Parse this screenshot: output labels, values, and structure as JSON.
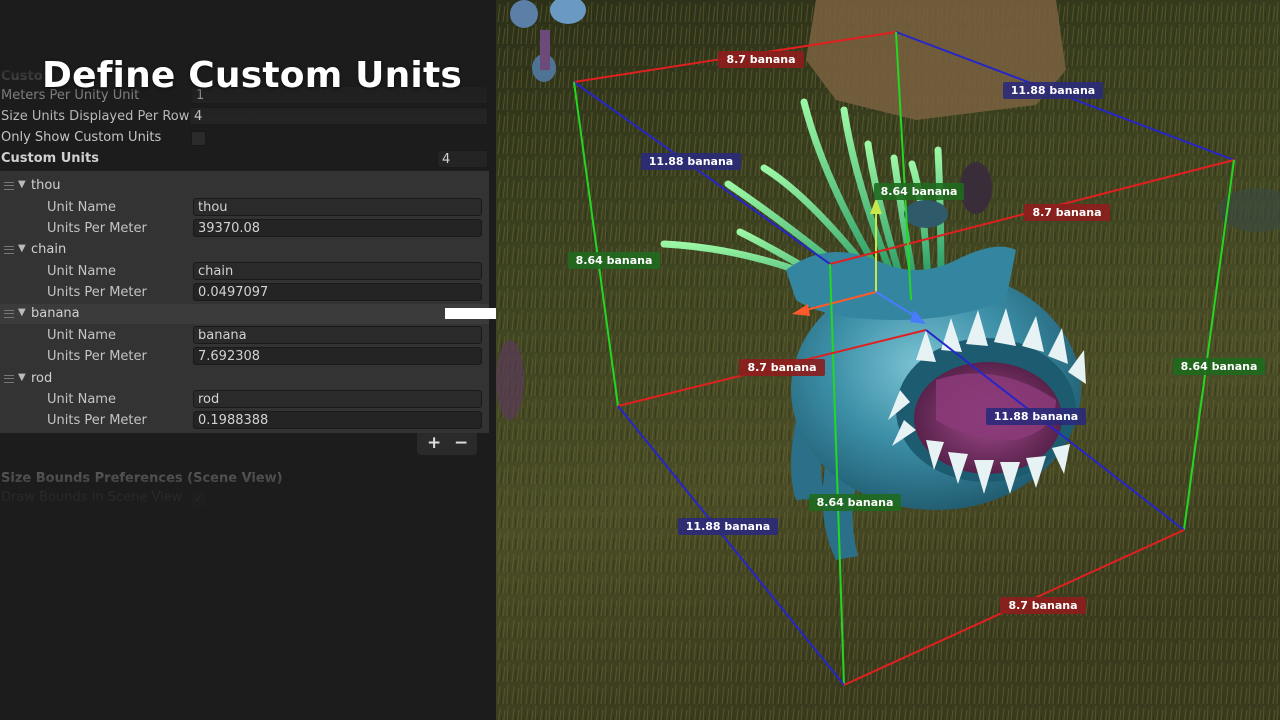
{
  "headline": "Define Custom Units",
  "inspector": {
    "section_title_partial": "Custo",
    "meters_per_unity_unit": {
      "label": "Meters Per Unity Unit",
      "value": "1"
    },
    "size_units_per_row": {
      "label": "Size Units Displayed Per Row",
      "value": "4"
    },
    "only_show_custom": {
      "label": "Only Show Custom Units",
      "checked": false
    },
    "custom_units": {
      "label": "Custom Units",
      "count": "4",
      "unit_name_label": "Unit Name",
      "units_per_meter_label": "Units Per Meter",
      "items": [
        {
          "header": "thou",
          "unit_name": "thou",
          "units_per_meter": "39370.08"
        },
        {
          "header": "chain",
          "unit_name": "chain",
          "units_per_meter": "0.0497097"
        },
        {
          "header": "banana",
          "unit_name": "banana",
          "units_per_meter": "7.692308"
        },
        {
          "header": "rod",
          "unit_name": "rod",
          "units_per_meter": "0.1988388"
        }
      ],
      "add_symbol": "+",
      "remove_symbol": "−"
    },
    "bounds_prefs_title": "Size Bounds Preferences (Scene View)",
    "draw_bounds": {
      "label": "Draw Bounds In Scene View",
      "checked": true
    }
  },
  "scene": {
    "labels": {
      "top_back_width": "8.7 banana",
      "top_back_depth": "11.88 banana",
      "top_left_depth": "11.88 banana",
      "top_height": "8.64 banana",
      "top_front_width": "8.7 banana",
      "left_height": "8.64 banana",
      "mid_width": "8.7 banana",
      "right_height": "8.64 banana",
      "mid_depth": "11.88 banana",
      "bottom_left_depth": "11.88 banana",
      "bottom_height": "8.64 banana",
      "bottom_width": "8.7 banana"
    },
    "colors": {
      "width_axis": "#e02020",
      "depth_axis": "#2626c8",
      "height_axis": "#22d822",
      "width_label_bg": "#8e1d1d",
      "depth_label_bg": "#2b2a7a",
      "height_label_bg": "#1f6a1f"
    }
  }
}
